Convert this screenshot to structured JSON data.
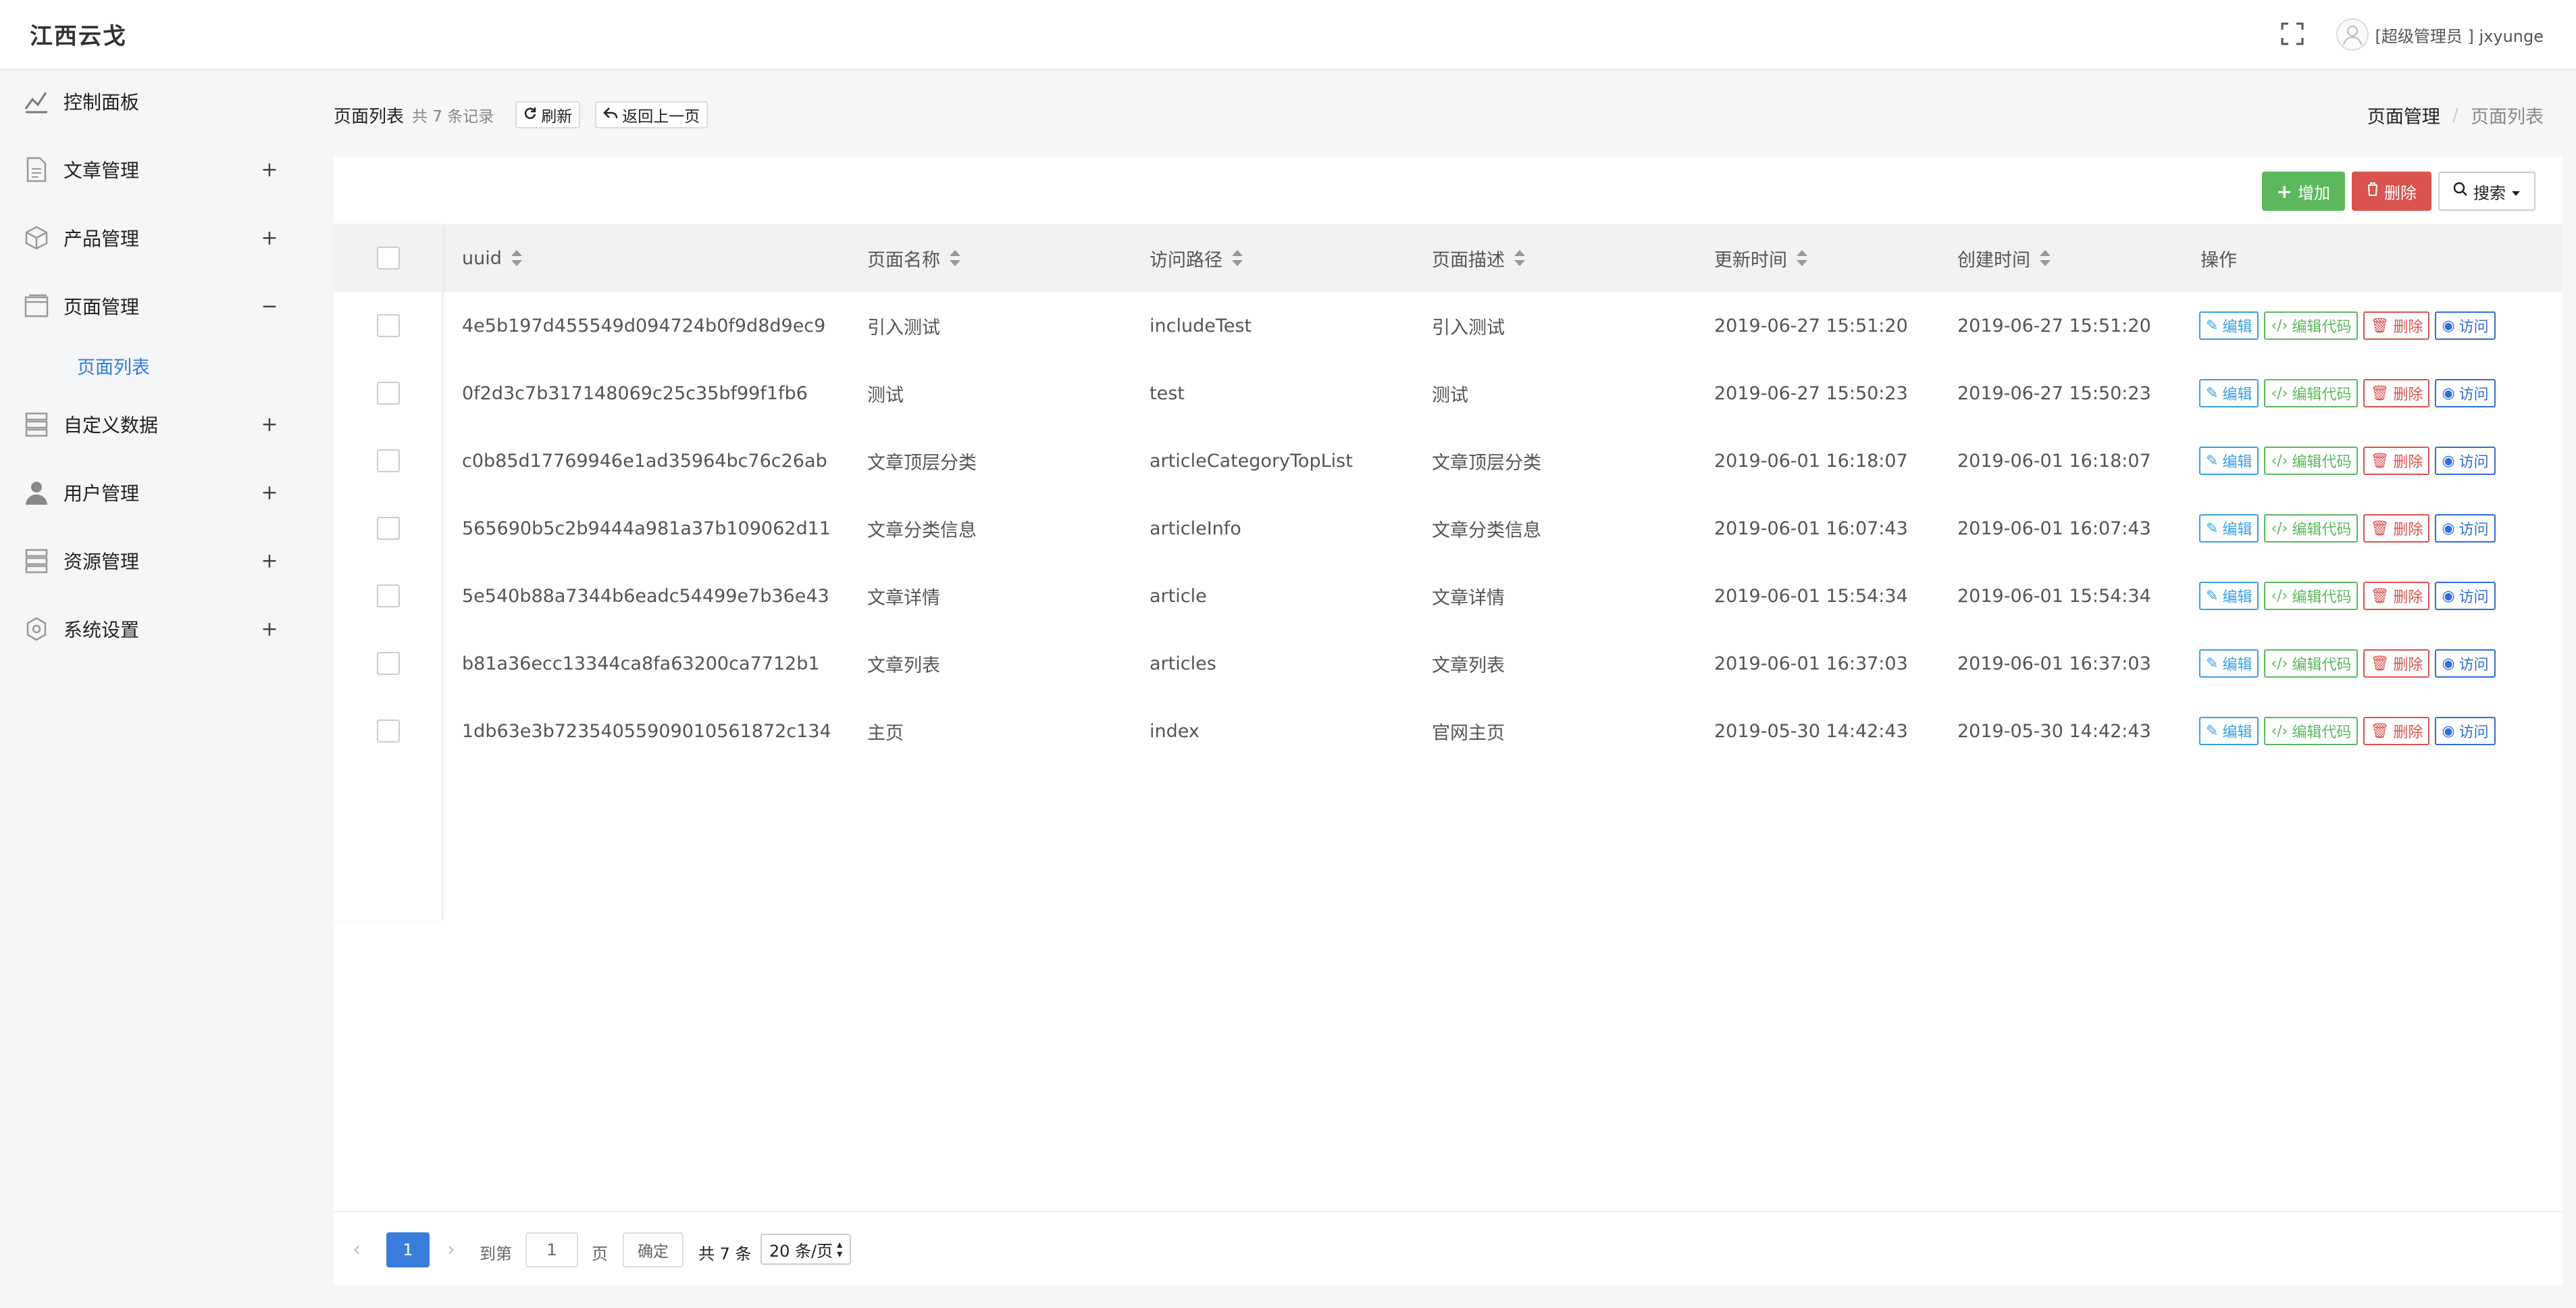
{
  "app": {
    "brand": "江西云戈",
    "user_label": "[超级管理员 ] jxyunge"
  },
  "sidebar": {
    "items": [
      {
        "label": "控制面板",
        "icon": "dashboard-icon",
        "toggle": ""
      },
      {
        "label": "文章管理",
        "icon": "document-icon",
        "toggle": "+"
      },
      {
        "label": "产品管理",
        "icon": "box-icon",
        "toggle": "+"
      },
      {
        "label": "页面管理",
        "icon": "window-icon",
        "toggle": "−"
      },
      {
        "label": "自定义数据",
        "icon": "database-icon",
        "toggle": "+"
      },
      {
        "label": "用户管理",
        "icon": "user-icon",
        "toggle": "+"
      },
      {
        "label": "资源管理",
        "icon": "server-icon",
        "toggle": "+"
      },
      {
        "label": "系统设置",
        "icon": "gear-icon",
        "toggle": "+"
      }
    ],
    "sub_item": "页面列表"
  },
  "header": {
    "title": "页面列表",
    "count": "共 7 条记录",
    "refresh": "刷新",
    "back": "返回上一页"
  },
  "breadcrumb": {
    "parent": "页面管理",
    "sep": "/",
    "current": "页面列表"
  },
  "toolbar": {
    "add": "增加",
    "delete": "删除",
    "search": "搜索"
  },
  "table": {
    "columns": [
      "uuid",
      "页面名称",
      "访问路径",
      "页面描述",
      "更新时间",
      "创建时间",
      "操作"
    ],
    "rows": [
      {
        "uuid": "4e5b197d455549d094724b0f9d8d9ec9",
        "name": "引入测试",
        "path": "includeTest",
        "desc": "引入测试",
        "updated": "2019-06-27 15:51:20",
        "created": "2019-06-27 15:51:20"
      },
      {
        "uuid": "0f2d3c7b317148069c25c35bf99f1fb6",
        "name": "测试",
        "path": "test",
        "desc": "测试",
        "updated": "2019-06-27 15:50:23",
        "created": "2019-06-27 15:50:23"
      },
      {
        "uuid": "c0b85d17769946e1ad35964bc76c26ab",
        "name": "文章顶层分类",
        "path": "articleCategoryTopList",
        "desc": "文章顶层分类",
        "updated": "2019-06-01 16:18:07",
        "created": "2019-06-01 16:18:07"
      },
      {
        "uuid": "565690b5c2b9444a981a37b109062d11",
        "name": "文章分类信息",
        "path": "articleInfo",
        "desc": "文章分类信息",
        "updated": "2019-06-01 16:07:43",
        "created": "2019-06-01 16:07:43"
      },
      {
        "uuid": "5e540b88a7344b6eadc54499e7b36e43",
        "name": "文章详情",
        "path": "article",
        "desc": "文章详情",
        "updated": "2019-06-01 15:54:34",
        "created": "2019-06-01 15:54:34"
      },
      {
        "uuid": "b81a36ecc13344ca8fa63200ca7712b1",
        "name": "文章列表",
        "path": "articles",
        "desc": "文章列表",
        "updated": "2019-06-01 16:37:03",
        "created": "2019-06-01 16:37:03"
      },
      {
        "uuid": "1db63e3b72354055909010561872c134",
        "name": "主页",
        "path": "index",
        "desc": "官网主页",
        "updated": "2019-05-30 14:42:43",
        "created": "2019-05-30 14:42:43"
      }
    ],
    "ops": {
      "edit": "编辑",
      "code": "编辑代码",
      "delete": "删除",
      "visit": "访问"
    }
  },
  "pager": {
    "current": "1",
    "goto_label": "到第",
    "goto_value": "1",
    "page_unit": "页",
    "confirm": "确定",
    "total": "共 7 条",
    "page_size": "20 条/页"
  },
  "colors": {
    "accent": "#3b7ddd",
    "success": "#5cb85c",
    "danger": "#d9534f",
    "info": "#3aa0e0"
  }
}
